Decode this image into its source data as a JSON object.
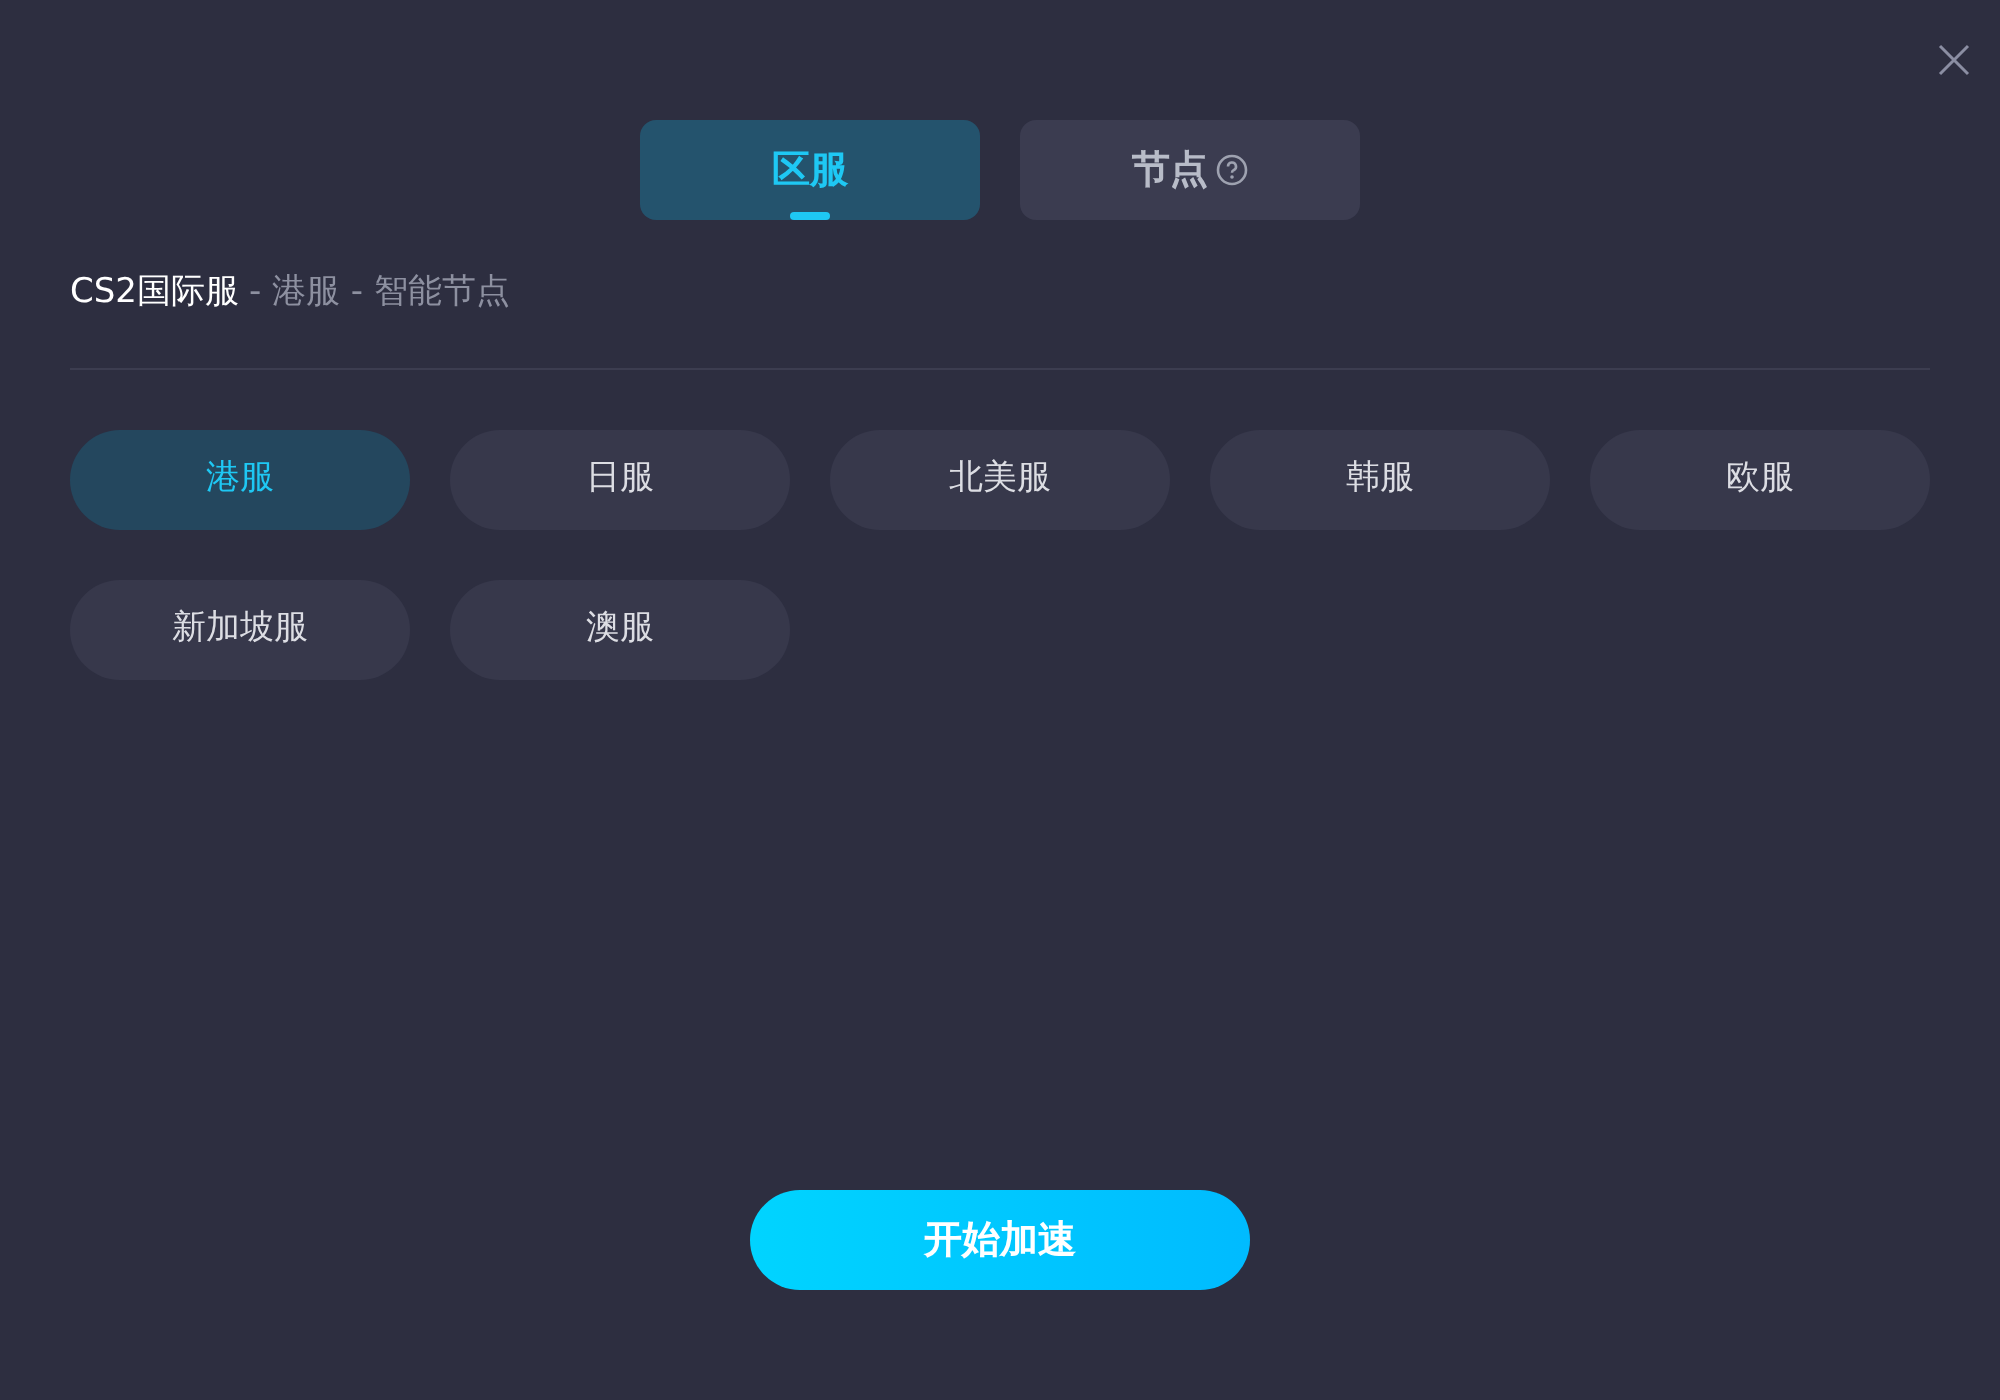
{
  "tabs": [
    {
      "label": "区服",
      "selected": true,
      "help": false
    },
    {
      "label": "节点",
      "selected": false,
      "help": true
    }
  ],
  "breadcrumb": {
    "title": "CS2国际服",
    "detail": "- 港服 - 智能节点"
  },
  "servers": [
    {
      "label": "港服",
      "selected": true
    },
    {
      "label": "日服",
      "selected": false
    },
    {
      "label": "北美服",
      "selected": false
    },
    {
      "label": "韩服",
      "selected": false
    },
    {
      "label": "欧服",
      "selected": false
    },
    {
      "label": "新加坡服",
      "selected": false
    },
    {
      "label": "澳服",
      "selected": false
    }
  ],
  "start_button": "开始加速"
}
